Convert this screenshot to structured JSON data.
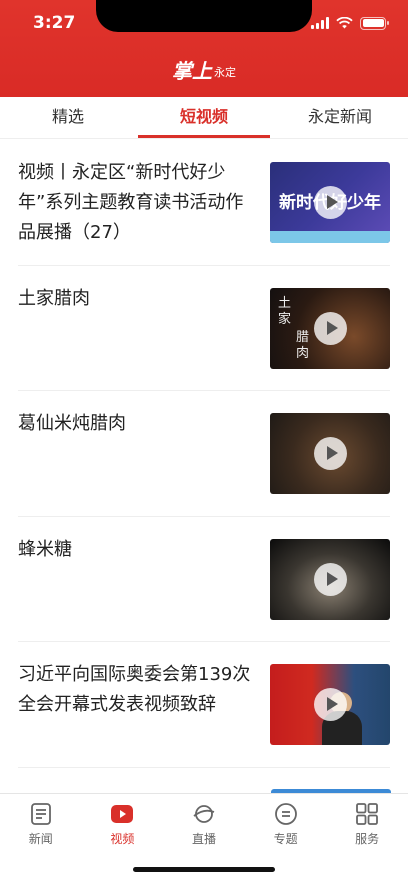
{
  "status_bar": {
    "time": "3:27"
  },
  "header": {
    "logo_main": "掌上",
    "logo_sub": "永定"
  },
  "tabs": [
    {
      "label": "精选",
      "active": false
    },
    {
      "label": "短视频",
      "active": true
    },
    {
      "label": "永定新闻",
      "active": false
    }
  ],
  "videos": [
    {
      "title": "视频丨永定区“新时代好少年”系列主题教育读书活动作品展播（27）",
      "thumb_caption": "新时代好少年"
    },
    {
      "title": "土家腊肉",
      "thumb_caption_a": "土家",
      "thumb_caption_b": "腊肉"
    },
    {
      "title": "葛仙米炖腊肉"
    },
    {
      "title": "蜂米糖"
    },
    {
      "title": "习近平向国际奥委会第139次全会开幕式发表视频致辞"
    }
  ],
  "bottom_nav": [
    {
      "label": "新闻",
      "icon": "news-icon",
      "active": false
    },
    {
      "label": "视频",
      "icon": "video-icon",
      "active": true
    },
    {
      "label": "直播",
      "icon": "live-icon",
      "active": false
    },
    {
      "label": "专题",
      "icon": "topic-icon",
      "active": false
    },
    {
      "label": "服务",
      "icon": "services-icon",
      "active": false
    }
  ],
  "colors": {
    "brand_red": "#d9302a",
    "header_red": "#e0342c"
  }
}
